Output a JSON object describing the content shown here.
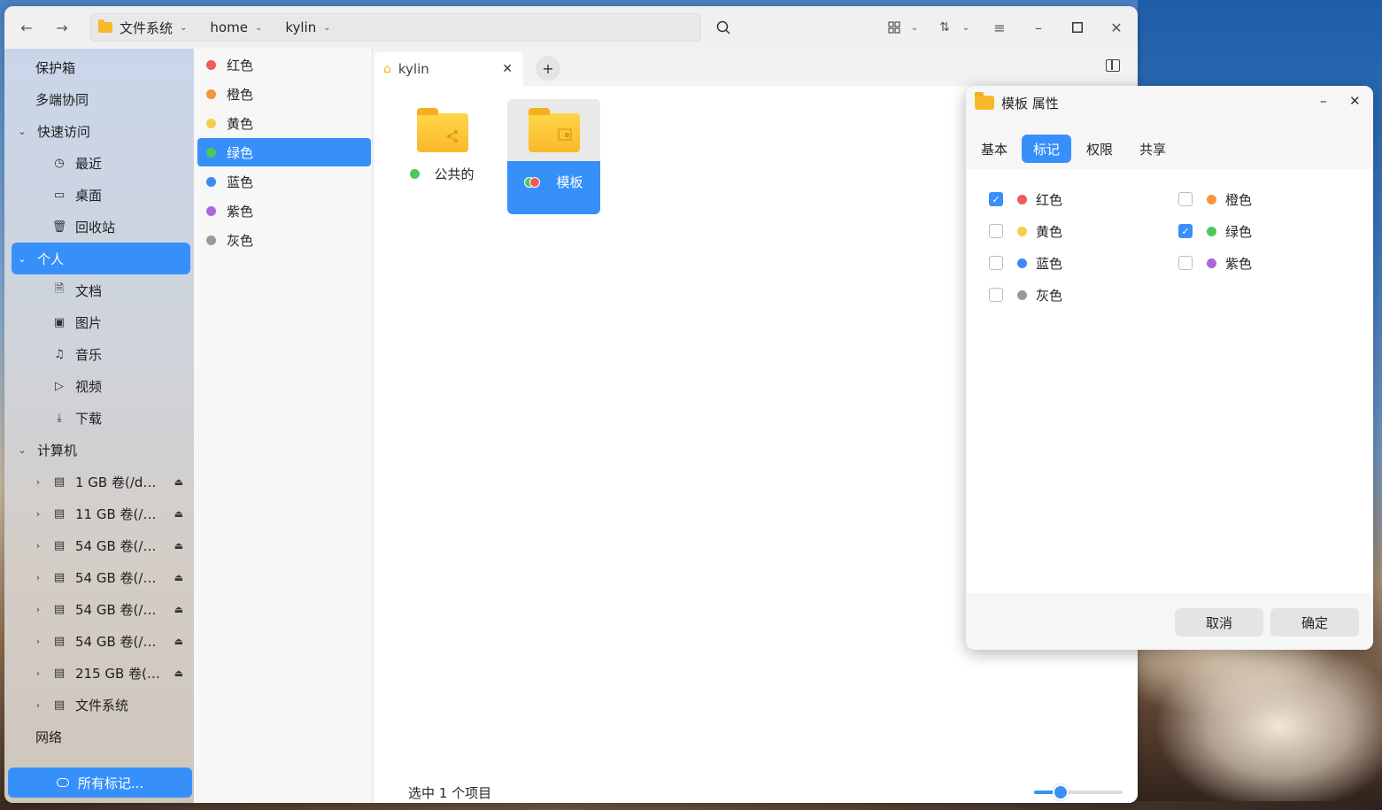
{
  "toolbar": {
    "path": [
      "文件系统",
      "home",
      "kylin"
    ]
  },
  "sidebar": {
    "items": [
      {
        "label": "保护箱"
      },
      {
        "label": "多端协同"
      },
      {
        "label": "快速访问"
      },
      {
        "label": "最近"
      },
      {
        "label": "桌面"
      },
      {
        "label": "回收站"
      },
      {
        "label": "个人"
      },
      {
        "label": "文档"
      },
      {
        "label": "图片"
      },
      {
        "label": "音乐"
      },
      {
        "label": "视频"
      },
      {
        "label": "下载"
      },
      {
        "label": "计算机"
      },
      {
        "label": "1 GB 卷(/d…"
      },
      {
        "label": "11 GB 卷(/…"
      },
      {
        "label": "54 GB 卷(/…"
      },
      {
        "label": "54 GB 卷(/…"
      },
      {
        "label": "54 GB 卷(/…"
      },
      {
        "label": "54 GB 卷(/…"
      },
      {
        "label": "215 GB 卷(…"
      },
      {
        "label": "文件系统"
      },
      {
        "label": "网络"
      }
    ],
    "all_tags": "所有标记..."
  },
  "tags": [
    {
      "label": "红色",
      "color": "#f05a5a"
    },
    {
      "label": "橙色",
      "color": "#f5963c"
    },
    {
      "label": "黄色",
      "color": "#f7cd4b"
    },
    {
      "label": "绿色",
      "color": "#4dc95a"
    },
    {
      "label": "蓝色",
      "color": "#3d8af0"
    },
    {
      "label": "紫色",
      "color": "#b066d6"
    },
    {
      "label": "灰色",
      "color": "#9a9a9a"
    }
  ],
  "main": {
    "tab_label": "kylin",
    "files": [
      {
        "name": "公共的"
      },
      {
        "name": "模板"
      }
    ],
    "status": "选中 1 个项目",
    "zoom_fraction": 0.3
  },
  "dialog": {
    "title": "模板 属性",
    "tabs": [
      "基本",
      "标记",
      "权限",
      "共享"
    ],
    "options": [
      {
        "label": "红色",
        "checked": true
      },
      {
        "label": "橙色",
        "checked": false
      },
      {
        "label": "黄色",
        "checked": false
      },
      {
        "label": "绿色",
        "checked": true
      },
      {
        "label": "蓝色",
        "checked": false
      },
      {
        "label": "紫色",
        "checked": false
      },
      {
        "label": "灰色",
        "checked": false
      }
    ],
    "cancel": "取消",
    "ok": "确定"
  }
}
